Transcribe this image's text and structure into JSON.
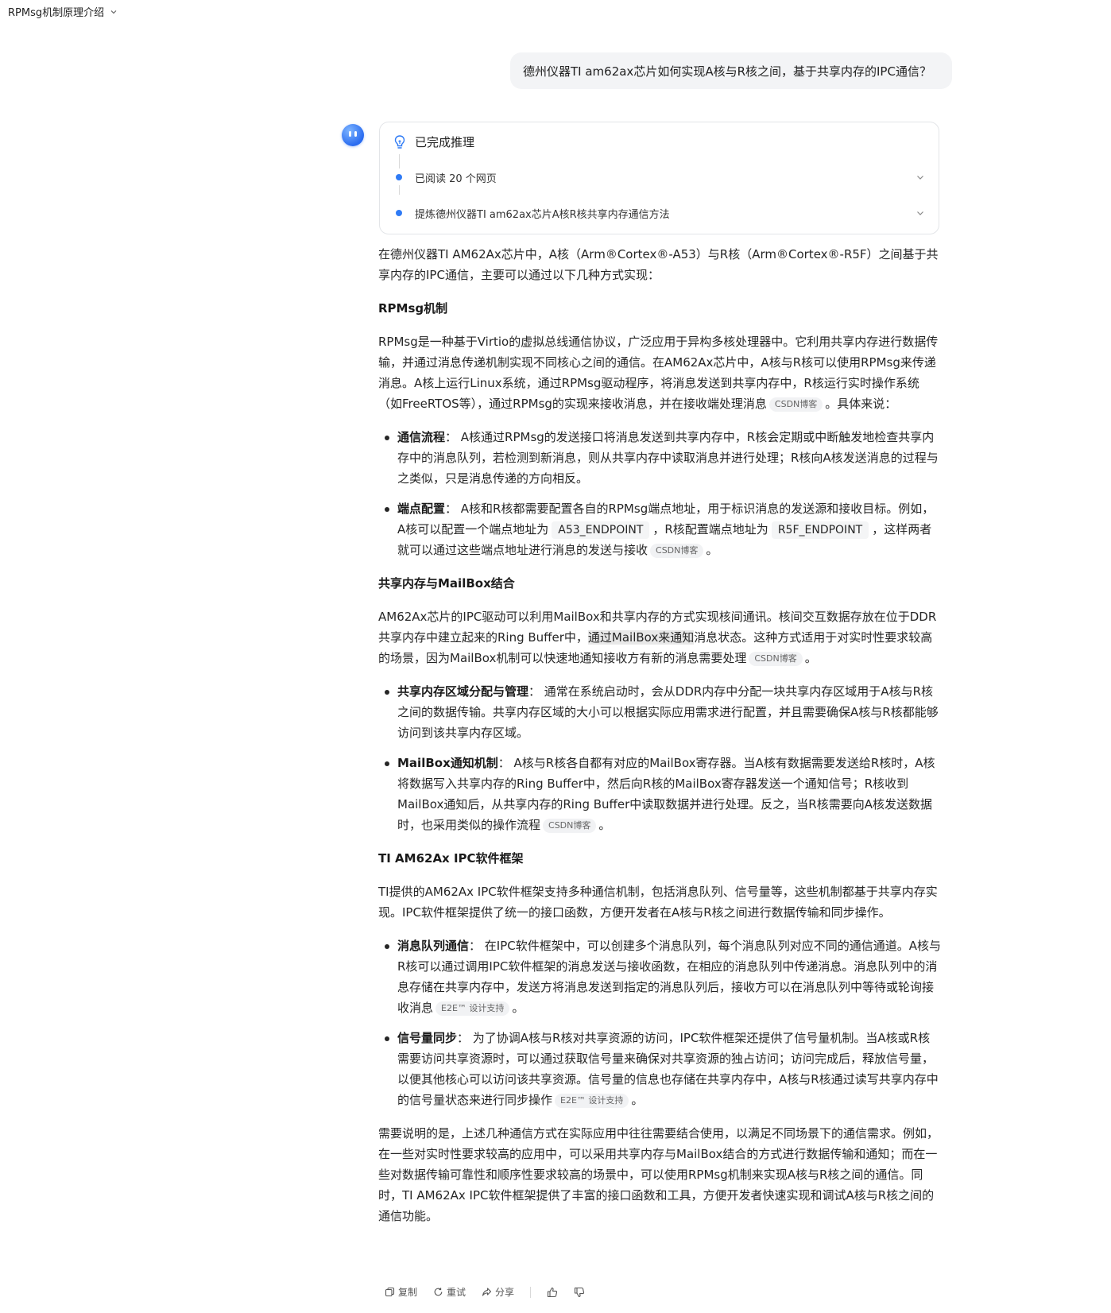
{
  "header": {
    "title": "RPMsg机制原理介绍"
  },
  "user_message": "德州仪器TI am62ax芯片如何实现A核与R核之间，基于共享内存的IPC通信？",
  "reasoning": {
    "title": "已完成推理",
    "steps": [
      "已阅读 20 个网页",
      "提炼德州仪器TI am62ax芯片A核R核共享内存通信方法"
    ]
  },
  "answer": {
    "intro": "在德州仪器TI AM62Ax芯片中，A核（Arm®Cortex®-A53）与R核（Arm®Cortex®-R5F）之间基于共享内存的IPC通信，主要可以通过以下几种方式实现：",
    "s1": {
      "heading": "RPMsg机制",
      "para": "RPMsg是一种基于Virtio的虚拟总线通信协议，广泛应用于异构多核处理器中。它利用共享内存进行数据传输，并通过消息传递机制实现不同核心之间的通信。在AM62Ax芯片中，A核与R核可以使用RPMsg来传递消息。A核上运行Linux系统，通过RPMsg驱动程序，将消息发送到共享内存中，R核运行实时操作系统（如FreeRTOS等），通过RPMsg的实现来接收消息，并在接收端处理消息",
      "para_cite": "CSDN博客",
      "para_tail": "。具体来说：",
      "b1_title": "通信流程",
      "b1_text": "： A核通过RPMsg的发送接口将消息发送到共享内存中，R核会定期或中断触发地检查共享内存中的消息队列，若检测到新消息，则从共享内存中读取消息并进行处理；R核向A核发送消息的过程与之类似，只是消息传递的方向相反。",
      "b2_title": "端点配置",
      "b2_text1": "： A核和R核都需要配置各自的RPMsg端点地址，用于标识消息的发送源和接收目标。例如，A核可以配置一个端点地址为",
      "b2_code1": "A53_ENDPOINT",
      "b2_text2": "，R核配置端点地址为",
      "b2_code2": "R5F_ENDPOINT",
      "b2_text3": "，这样两者就可以通过这些端点地址进行消息的发送与接收",
      "b2_cite": "CSDN博客",
      "b2_tail": "。"
    },
    "s2": {
      "heading": "共享内存与MailBox结合",
      "para1": "AM62Ax芯片的IPC驱动可以利用MailBox和共享内存的方式实现核间通讯。核间交互数据存放在位于DDR共享内存中建立起来的Ring Buffer中，",
      "para_hl": "通过MailBox来通知",
      "para2": "消息状态。这种方式适用于对实时性要求较高的场景，因为MailBox机制可以快速地通知接收方有新的消息需要处理",
      "para_cite": "CSDN博客",
      "para_tail": "。",
      "b1_title": "共享内存区域分配与管理",
      "b1_text": "： 通常在系统启动时，会从DDR内存中分配一块共享内存区域用于A核与R核之间的数据传输。共享内存区域的大小可以根据实际应用需求进行配置，并且需要确保A核与R核都能够访问到该共享内存区域。",
      "b2_title": "MailBox通知机制",
      "b2_text": "： A核与R核各自都有对应的MailBox寄存器。当A核有数据需要发送给R核时，A核将数据写入共享内存的Ring Buffer中，然后向R核的MailBox寄存器发送一个通知信号；R核收到MailBox通知后，从共享内存的Ring Buffer中读取数据并进行处理。反之，当R核需要向A核发送数据时，也采用类似的操作流程",
      "b2_cite": "CSDN博客",
      "b2_tail": "。"
    },
    "s3": {
      "heading": "TI AM62Ax IPC软件框架",
      "para": "TI提供的AM62Ax IPC软件框架支持多种通信机制，包括消息队列、信号量等，这些机制都基于共享内存实现。IPC软件框架提供了统一的接口函数，方便开发者在A核与R核之间进行数据传输和同步操作。",
      "b1_title": "消息队列通信",
      "b1_text": "： 在IPC软件框架中，可以创建多个消息队列，每个消息队列对应不同的通信通道。A核与R核可以通过调用IPC软件框架的消息发送与接收函数，在相应的消息队列中传递消息。消息队列中的消息存储在共享内存中，发送方将消息发送到指定的消息队列后，接收方可以在消息队列中等待或轮询接收消息",
      "b1_cite": "E2E™ 设计支持",
      "b1_tail": "。",
      "b2_title": "信号量同步",
      "b2_text": "： 为了协调A核与R核对共享资源的访问，IPC软件框架还提供了信号量机制。当A核或R核需要访问共享资源时，可以通过获取信号量来确保对共享资源的独占访问；访问完成后，释放信号量，以便其他核心可以访问该共享资源。信号量的信息也存储在共享内存中，A核与R核通过读写共享内存中的信号量状态来进行同步操作",
      "b2_cite": "E2E™ 设计支持",
      "b2_tail": "。"
    },
    "conclusion": "需要说明的是，上述几种通信方式在实际应用中往往需要结合使用，以满足不同场景下的通信需求。例如，在一些对实时性要求较高的应用中，可以采用共享内存与MailBox结合的方式进行数据传输和通知；而在一些对数据传输可靠性和顺序性要求较高的场景中，可以使用RPMsg机制来实现A核与R核之间的通信。同时，TI AM62Ax IPC软件框架提供了丰富的接口函数和工具，方便开发者快速实现和调试A核与R核之间的通信功能。"
  },
  "actions": {
    "copy": "复制",
    "retry": "重试",
    "share": "分享"
  },
  "colors": {
    "accent": "#2f7bf5",
    "bubble": "#f3f4f6",
    "cite_bg": "#f1f2f4"
  },
  "icons": [
    "chevron-down-icon",
    "lightbulb-icon",
    "copy-icon",
    "refresh-icon",
    "share-icon",
    "thumbs-up-icon",
    "thumbs-down-icon"
  ]
}
